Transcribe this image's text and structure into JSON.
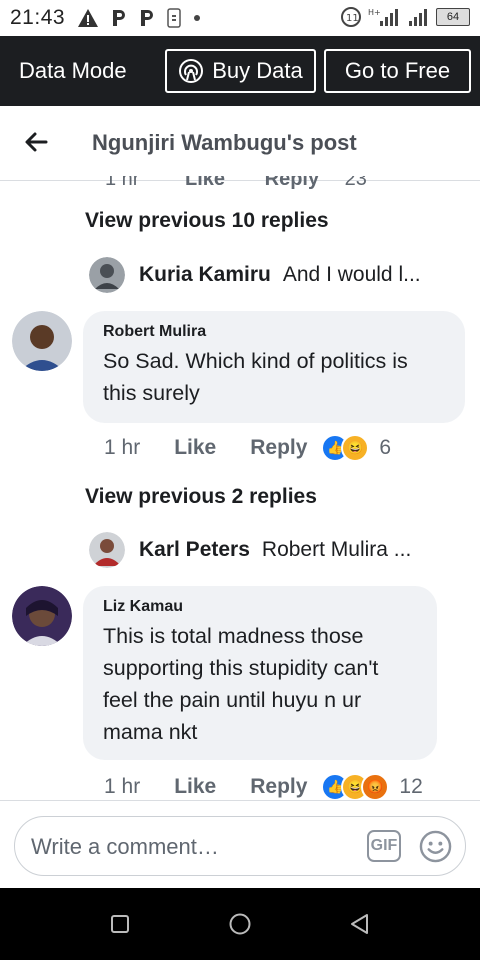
{
  "status_bar": {
    "time": "21:43",
    "battery": "64"
  },
  "data_bar": {
    "mode_label": "Data Mode",
    "buy_label": "Buy Data",
    "free_label": "Go to Free"
  },
  "header": {
    "title": "Ngunjiri Wambugu's post"
  },
  "partial_row": {
    "time": "1 hr",
    "like": "Like",
    "reply": "Reply",
    "count": "23"
  },
  "thread1": {
    "view_previous": "View previous 10 replies",
    "preview": {
      "name": "Kuria Kamiru",
      "text": "And I would l..."
    },
    "comment": {
      "author": "Robert Mulira",
      "text": "So Sad. Which kind of politics is this surely",
      "time": "1 hr",
      "like": "Like",
      "reply": "Reply",
      "count": "6",
      "reactions": [
        "like",
        "haha"
      ]
    }
  },
  "thread2": {
    "view_previous": "View previous 2 replies",
    "preview": {
      "name": "Karl Peters",
      "text": "Robert Mulira ..."
    },
    "comment": {
      "author": "Liz Kamau",
      "text": "This is total madness those supporting this stupidity can't feel the pain until huyu n ur mama nkt",
      "time": "1 hr",
      "like": "Like",
      "reply": "Reply",
      "count": "12",
      "reactions": [
        "like",
        "haha",
        "angry"
      ]
    }
  },
  "composer": {
    "placeholder": "Write a comment…",
    "gif_label": "GIF"
  },
  "colors": {
    "dark_bar": "#1c1e21",
    "bubble": "#f0f2f5",
    "like_blue": "#1877f2",
    "haha_yellow": "#f7b125",
    "angry_orange": "#e9710f"
  }
}
